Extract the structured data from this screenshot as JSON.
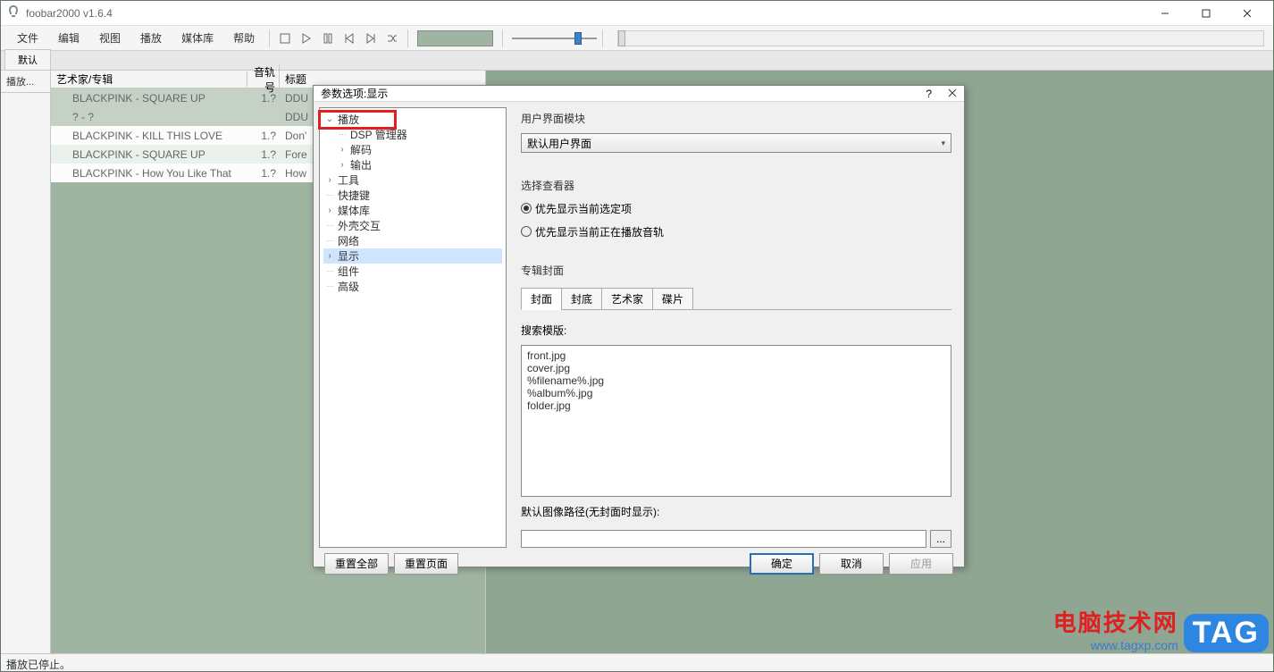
{
  "window": {
    "title": "foobar2000 v1.6.4"
  },
  "menu": {
    "file": "文件",
    "edit": "编辑",
    "view": "视图",
    "playback": "播放",
    "library": "媒体库",
    "help": "帮助"
  },
  "tabs": {
    "default": "默认"
  },
  "sidebar": {
    "header": "播放..."
  },
  "playlist": {
    "headers": {
      "artist": "艺术家/专辑",
      "track": "音轨号",
      "title": "标题"
    },
    "rows": [
      {
        "artist": "BLACKPINK - SQUARE UP",
        "track": "1.?",
        "title": "DDU"
      },
      {
        "artist": "? - ?",
        "track": "",
        "title": "DDU"
      },
      {
        "artist": "BLACKPINK - KILL THIS LOVE",
        "track": "1.?",
        "title": "Don'"
      },
      {
        "artist": "BLACKPINK - SQUARE UP",
        "track": "1.?",
        "title": "Fore"
      },
      {
        "artist": "BLACKPINK - How You Like That",
        "track": "1.?",
        "title": "How"
      }
    ]
  },
  "status": {
    "text": "播放已停止。"
  },
  "dialog": {
    "title": "参数选项:显示",
    "tree": {
      "playback": "播放",
      "dsp": "DSP 管理器",
      "decode": "解码",
      "output": "输出",
      "tools": "工具",
      "hotkeys": "快捷键",
      "library": "媒体库",
      "shell": "外壳交互",
      "network": "网络",
      "display": "显示",
      "components": "组件",
      "advanced": "高级"
    },
    "right": {
      "uiModuleLabel": "用户界面模块",
      "uiModuleValue": "默认用户界面",
      "viewerLabel": "选择查看器",
      "radio1": "优先显示当前选定项",
      "radio2": "优先显示当前正在播放音轨",
      "albumArtLabel": "专辑封面",
      "subtabs": {
        "front": "封面",
        "back": "封底",
        "artist": "艺术家",
        "disc": "碟片"
      },
      "searchLabel": "搜索模版:",
      "searchText": "front.jpg\ncover.jpg\n%filename%.jpg\n%album%.jpg\nfolder.jpg",
      "defaultPathLabel": "默认图像路径(无封面时显示):",
      "browseBtn": "..."
    },
    "footer": {
      "resetAll": "重置全部",
      "resetPage": "重置页面",
      "ok": "确定",
      "cancel": "取消",
      "apply": "应用"
    }
  },
  "watermark": {
    "line1": "电脑技术网",
    "line2": "www.tagxp.com",
    "tag": "TAG"
  }
}
